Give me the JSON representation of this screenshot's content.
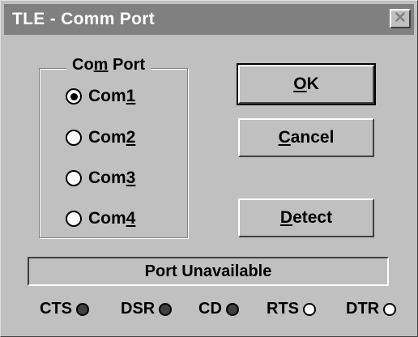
{
  "window": {
    "title": "TLE - Comm Port",
    "close_symbol": "✕"
  },
  "comport_group": {
    "label_pre": "Co",
    "label_mn": "m",
    "label_post": " Port",
    "options": [
      {
        "pre": "Com",
        "mn": "1",
        "selected": true
      },
      {
        "pre": "Com",
        "mn": "2",
        "selected": false
      },
      {
        "pre": "Com",
        "mn": "3",
        "selected": false
      },
      {
        "pre": "Com",
        "mn": "4",
        "selected": false
      }
    ]
  },
  "buttons": {
    "ok": {
      "mn": "O",
      "rest": "K"
    },
    "cancel": {
      "mn": "C",
      "rest": "ancel"
    },
    "detect": {
      "mn": "D",
      "rest": "etect"
    }
  },
  "status": {
    "text": "Port Unavailable"
  },
  "signals": [
    {
      "label": "CTS",
      "state": "on"
    },
    {
      "label": "DSR",
      "state": "on"
    },
    {
      "label": "CD",
      "state": "on"
    },
    {
      "label": "RTS",
      "state": "off"
    },
    {
      "label": "DTR",
      "state": "off"
    }
  ],
  "colors": {
    "face": "#c0c0c0",
    "title_inactive": "#808080",
    "led_on": "#404040",
    "led_off": "#ffffff"
  }
}
